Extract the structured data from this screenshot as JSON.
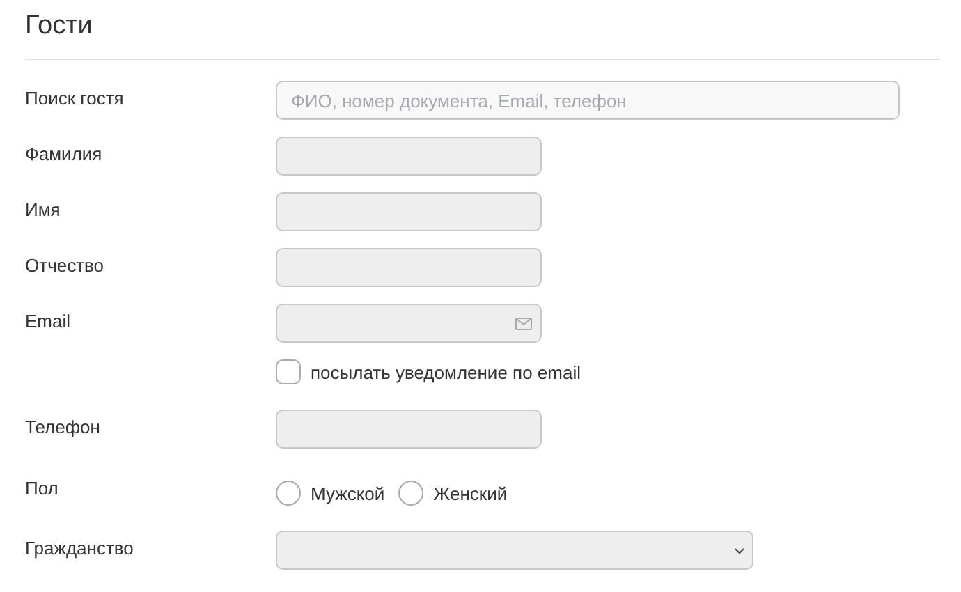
{
  "title": "Гости",
  "fields": [
    {
      "kind": "search",
      "label": "Поиск гостя",
      "placeholder": "ФИО, номер документа, Email, телефон"
    },
    {
      "kind": "text",
      "label": "Фамилия"
    },
    {
      "kind": "text",
      "label": "Имя"
    },
    {
      "kind": "text",
      "label": "Отчество"
    },
    {
      "kind": "email",
      "label": "Email"
    },
    {
      "kind": "checkbox",
      "text": "посылать уведомление по email",
      "checked": false
    },
    {
      "kind": "text",
      "label": "Телефон"
    },
    {
      "kind": "radio",
      "label": "Пол",
      "options": [
        {
          "text": "Мужской",
          "selected": false
        },
        {
          "text": "Женский",
          "selected": false
        }
      ]
    },
    {
      "kind": "select",
      "label": "Гражданство"
    }
  ]
}
